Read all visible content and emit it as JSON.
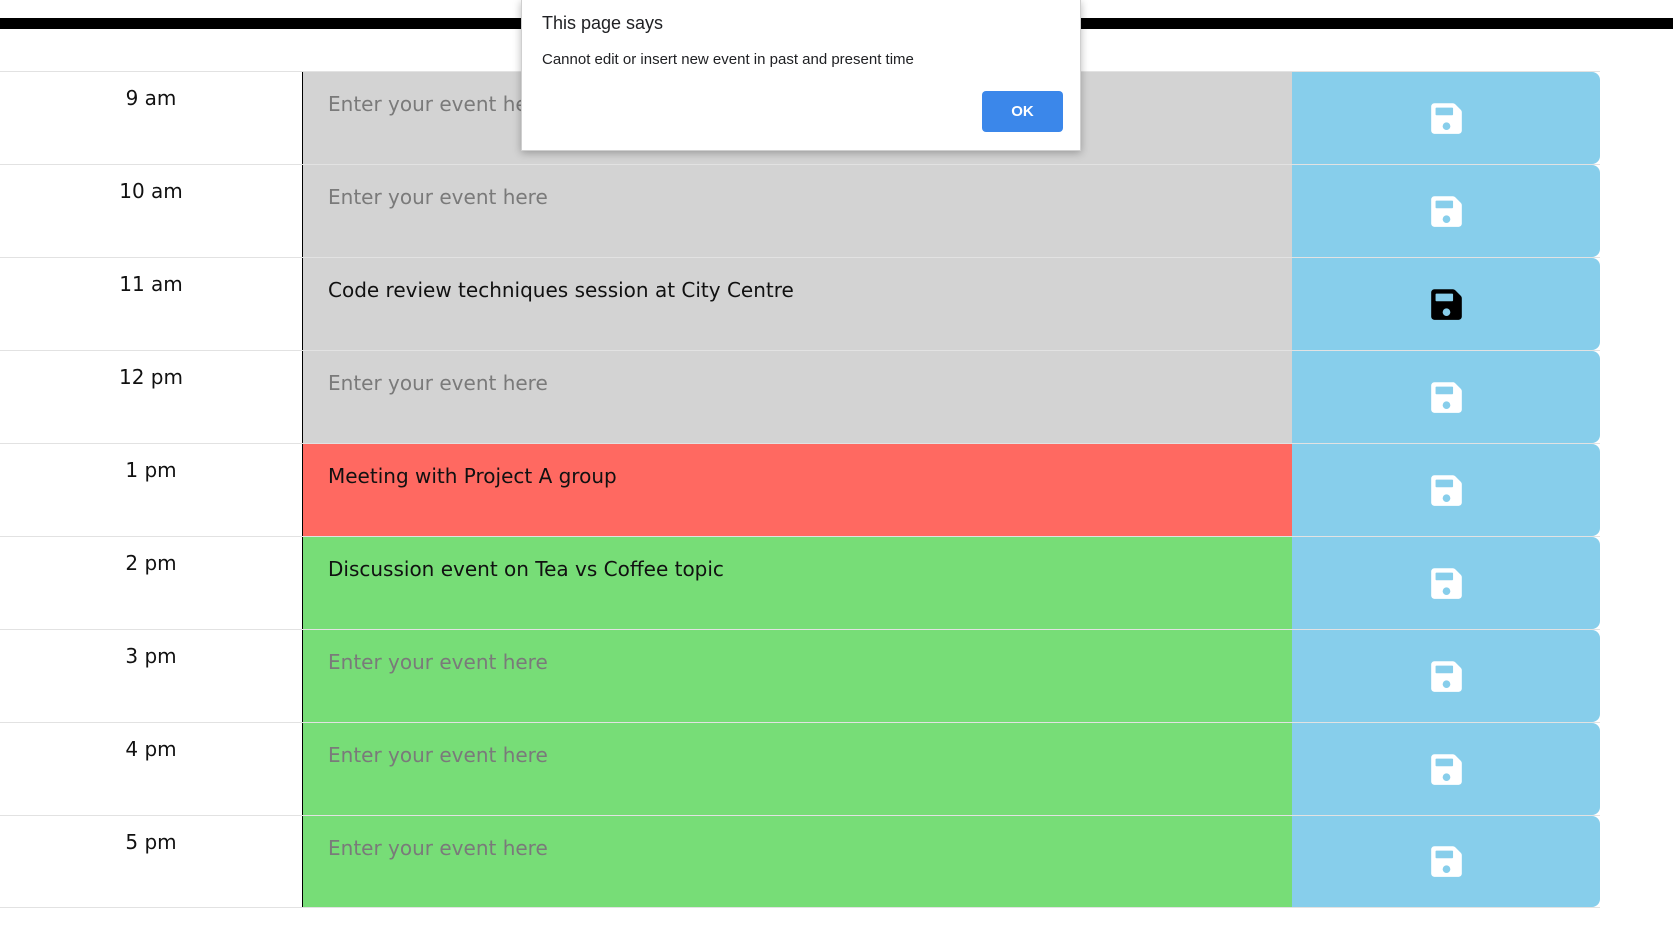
{
  "dialog": {
    "title": "This page says",
    "message": "Cannot edit or insert new event in past and present time",
    "ok_label": "OK"
  },
  "colors": {
    "past": "#d3d3d3",
    "present": "#ff6961",
    "future": "#77dd77",
    "save_button": "#87ceeb",
    "save_icon_default": "#ffffff",
    "save_icon_active": "#000000",
    "dialog_button": "#3b87ea"
  },
  "rows": [
    {
      "hour": "9 am",
      "value": "",
      "placeholder": "Enter your event here",
      "state": "past",
      "save_icon": "floppy-disk-icon",
      "icon_active": false
    },
    {
      "hour": "10 am",
      "value": "",
      "placeholder": "Enter your event here",
      "state": "past",
      "save_icon": "floppy-disk-icon",
      "icon_active": false
    },
    {
      "hour": "11 am",
      "value": "Code review techniques session at City Centre",
      "placeholder": "Enter your event here",
      "state": "past",
      "save_icon": "floppy-disk-icon",
      "icon_active": true
    },
    {
      "hour": "12 pm",
      "value": "",
      "placeholder": "Enter your event here",
      "state": "past",
      "save_icon": "floppy-disk-icon",
      "icon_active": false
    },
    {
      "hour": "1 pm",
      "value": "Meeting with Project A group",
      "placeholder": "Enter your event here",
      "state": "present",
      "save_icon": "floppy-disk-icon",
      "icon_active": false
    },
    {
      "hour": "2 pm",
      "value": "Discussion event on Tea vs Coffee topic",
      "placeholder": "Enter your event here",
      "state": "future",
      "save_icon": "floppy-disk-icon",
      "icon_active": false
    },
    {
      "hour": "3 pm",
      "value": "",
      "placeholder": "Enter your event here",
      "state": "future",
      "save_icon": "floppy-disk-icon",
      "icon_active": false
    },
    {
      "hour": "4 pm",
      "value": "",
      "placeholder": "Enter your event here",
      "state": "future",
      "save_icon": "floppy-disk-icon",
      "icon_active": false
    },
    {
      "hour": "5 pm",
      "value": "",
      "placeholder": "Enter your event here",
      "state": "future",
      "save_icon": "floppy-disk-icon",
      "icon_active": false
    }
  ]
}
